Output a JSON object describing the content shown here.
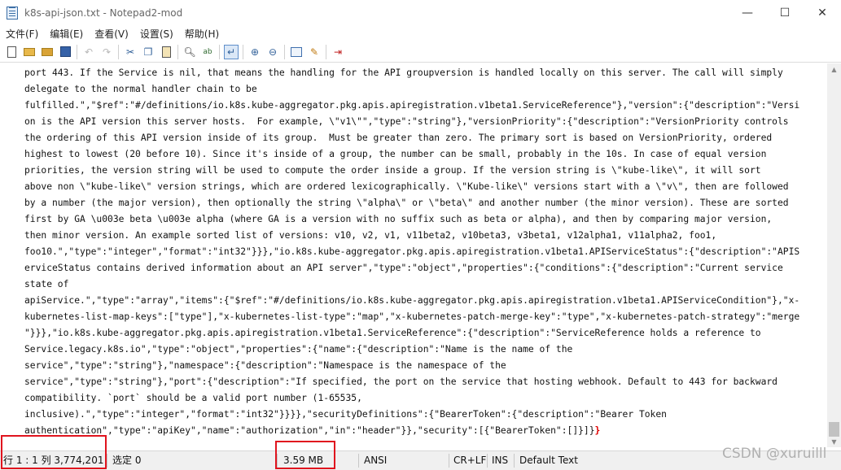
{
  "window": {
    "title": "k8s-api-json.txt - Notepad2-mod",
    "controls": {
      "minimize": "—",
      "maximize": "☐",
      "close": "✕"
    }
  },
  "menu": [
    {
      "label": "文件(F)"
    },
    {
      "label": "编辑(E)"
    },
    {
      "label": "查看(V)"
    },
    {
      "label": "设置(S)"
    },
    {
      "label": "帮助(H)"
    }
  ],
  "toolbar_icons": [
    "new-icon",
    "open-icon",
    "browse-icon",
    "save-icon",
    "undo-icon",
    "redo-icon",
    "cut-icon",
    "copy-icon",
    "paste-icon",
    "find-icon",
    "replace-icon",
    "word-wrap-icon",
    "zoom-in-icon",
    "zoom-out-icon",
    "scheme-icon",
    "customize-icon",
    "exit-icon"
  ],
  "editor": {
    "lines": [
      "port 443. If the Service is nil, that means the handling for the API groupversion is handled locally on this server. The call will simply",
      "delegate to the normal handler chain to be",
      "fulfilled.\",\"$ref\":\"#/definitions/io.k8s.kube-aggregator.pkg.apis.apiregistration.v1beta1.ServiceReference\"},\"version\":{\"description\":\"Versi",
      "on is the API version this server hosts.  For example, \\\"v1\\\"\",\"type\":\"string\"},\"versionPriority\":{\"description\":\"VersionPriority controls",
      "the ordering of this API version inside of its group.  Must be greater than zero. The primary sort is based on VersionPriority, ordered",
      "highest to lowest (20 before 10). Since it's inside of a group, the number can be small, probably in the 10s. In case of equal version",
      "priorities, the version string will be used to compute the order inside a group. If the version string is \\\"kube-like\\\", it will sort",
      "above non \\\"kube-like\\\" version strings, which are ordered lexicographically. \\\"Kube-like\\\" versions start with a \\\"v\\\", then are followed",
      "by a number (the major version), then optionally the string \\\"alpha\\\" or \\\"beta\\\" and another number (the minor version). These are sorted",
      "first by GA \\u003e beta \\u003e alpha (where GA is a version with no suffix such as beta or alpha), and then by comparing major version,",
      "then minor version. An example sorted list of versions: v10, v2, v1, v11beta2, v10beta3, v3beta1, v12alpha1, v11alpha2, foo1,",
      "foo10.\",\"type\":\"integer\",\"format\":\"int32\"}}},\"io.k8s.kube-aggregator.pkg.apis.apiregistration.v1beta1.APIServiceStatus\":{\"description\":\"APIS",
      "erviceStatus contains derived information about an API server\",\"type\":\"object\",\"properties\":{\"conditions\":{\"description\":\"Current service",
      "state of",
      "apiService.\",\"type\":\"array\",\"items\":{\"$ref\":\"#/definitions/io.k8s.kube-aggregator.pkg.apis.apiregistration.v1beta1.APIServiceCondition\"},\"x-",
      "kubernetes-list-map-keys\":[\"type\"],\"x-kubernetes-list-type\":\"map\",\"x-kubernetes-patch-merge-key\":\"type\",\"x-kubernetes-patch-strategy\":\"merge",
      "\"}}},\"io.k8s.kube-aggregator.pkg.apis.apiregistration.v1beta1.ServiceReference\":{\"description\":\"ServiceReference holds a reference to",
      "Service.legacy.k8s.io\",\"type\":\"object\",\"properties\":{\"name\":{\"description\":\"Name is the name of the",
      "service\",\"type\":\"string\"},\"namespace\":{\"description\":\"Namespace is the namespace of the",
      "service\",\"type\":\"string\"},\"port\":{\"description\":\"If specified, the port on the service that hosting webhook. Default to 443 for backward",
      "compatibility. `port` should be a valid port number (1-65535,",
      "inclusive).\",\"type\":\"integer\",\"format\":\"int32\"}}}},\"securityDefinitions\":{\"BearerToken\":{\"description\":\"Bearer Token",
      "authentication\",\"type\":\"apiKey\",\"name\":\"authorization\",\"in\":\"header\"}},\"security\":[{\"BearerToken\":[]}]}"
    ],
    "last_brace": "}"
  },
  "statusbar": {
    "position": "行 1 : 1   列 3,774,201",
    "selection": "选定 0",
    "size": "3.59 MB",
    "encoding": "ANSI",
    "eol": "CR+LF",
    "ins": "INS",
    "scheme": "Default Text"
  },
  "watermark": "CSDN @xuruilll",
  "highlight_color": "#e0141e"
}
